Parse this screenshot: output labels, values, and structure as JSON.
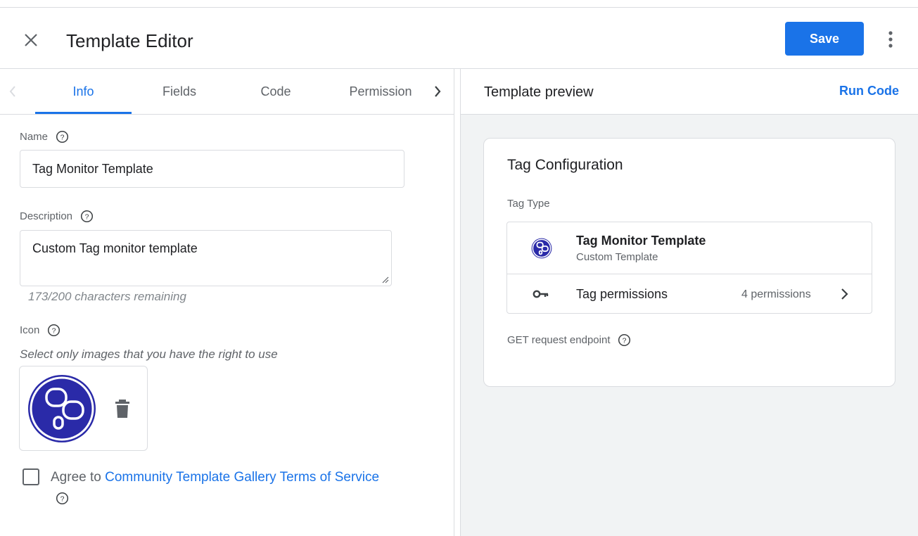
{
  "header": {
    "title": "Template Editor",
    "save_label": "Save"
  },
  "tabs": [
    {
      "label": "Info",
      "active": true
    },
    {
      "label": "Fields",
      "active": false
    },
    {
      "label": "Code",
      "active": false
    },
    {
      "label": "Permission",
      "active": false
    }
  ],
  "form": {
    "name_label": "Name",
    "name_value": "Tag Monitor Template",
    "description_label": "Description",
    "description_value": "Custom Tag monitor template",
    "char_counter": "173/200 characters remaining",
    "icon_label": "Icon",
    "icon_hint": "Select only images that you have the right to use",
    "agree_prefix": "Agree to",
    "agree_link": "Community Template Gallery Terms of Service",
    "agree_checked": false
  },
  "preview": {
    "title": "Template preview",
    "run_code_label": "Run Code",
    "card_title": "Tag Configuration",
    "tag_type_label": "Tag Type",
    "tag_name": "Tag Monitor Template",
    "tag_subtitle": "Custom Template",
    "permissions_label": "Tag permissions",
    "permissions_count": "4 permissions",
    "endpoint_label": "GET request endpoint"
  },
  "colors": {
    "accent": "#1a73e8",
    "icon_blue": "#2a2aa8",
    "panel_bg": "#f1f3f4"
  },
  "icons": [
    "close-icon",
    "more-vert-icon",
    "chevron-left-icon",
    "chevron-right-icon",
    "help-icon",
    "trash-icon",
    "key-icon",
    "template-logo-icon"
  ]
}
